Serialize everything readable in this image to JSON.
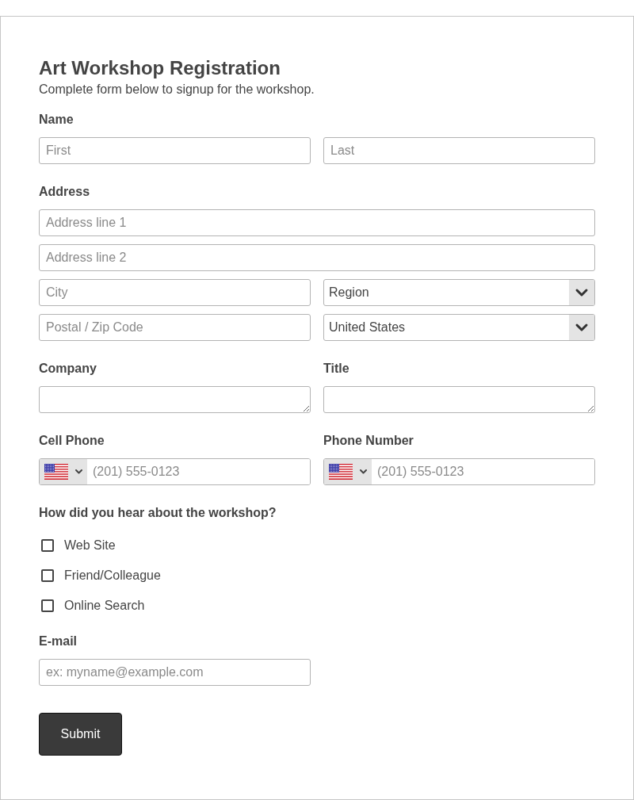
{
  "title": "Art Workshop Registration",
  "subtitle": "Complete form below to signup for the workshop.",
  "sections": [
    {
      "kind": "fields",
      "label": "Name",
      "rows": [
        [
          {
            "kind": "input",
            "placeholder": "First"
          },
          {
            "kind": "input",
            "placeholder": "Last"
          }
        ]
      ]
    },
    {
      "kind": "fields",
      "label": "Address",
      "rows": [
        [
          {
            "kind": "input",
            "placeholder": "Address line 1"
          }
        ],
        [
          {
            "kind": "input",
            "placeholder": "Address line 2"
          }
        ],
        [
          {
            "kind": "input",
            "placeholder": "City"
          },
          {
            "kind": "select",
            "value": "Region"
          }
        ],
        [
          {
            "kind": "input",
            "placeholder": "Postal / Zip Code"
          },
          {
            "kind": "select",
            "value": "United States"
          }
        ]
      ]
    },
    {
      "kind": "split",
      "columns": [
        {
          "label": "Company",
          "field": {
            "kind": "textarea"
          }
        },
        {
          "label": "Title",
          "field": {
            "kind": "textarea"
          }
        }
      ]
    },
    {
      "kind": "split",
      "columns": [
        {
          "label": "Cell Phone",
          "field": {
            "kind": "phone",
            "placeholder": "(201) 555-0123"
          }
        },
        {
          "label": "Phone Number",
          "field": {
            "kind": "phone",
            "placeholder": "(201) 555-0123"
          }
        }
      ]
    },
    {
      "kind": "checkboxes",
      "label": "How did you hear about the workshop?",
      "options": [
        {
          "label": "Web Site",
          "checked": false
        },
        {
          "label": "Friend/Colleague",
          "checked": false
        },
        {
          "label": "Online Search",
          "checked": false
        }
      ]
    },
    {
      "kind": "split",
      "columns": [
        {
          "label": "E-mail",
          "field": {
            "kind": "input",
            "placeholder": "ex: myname@example.com"
          }
        }
      ]
    }
  ],
  "submit": {
    "label": "Submit"
  }
}
